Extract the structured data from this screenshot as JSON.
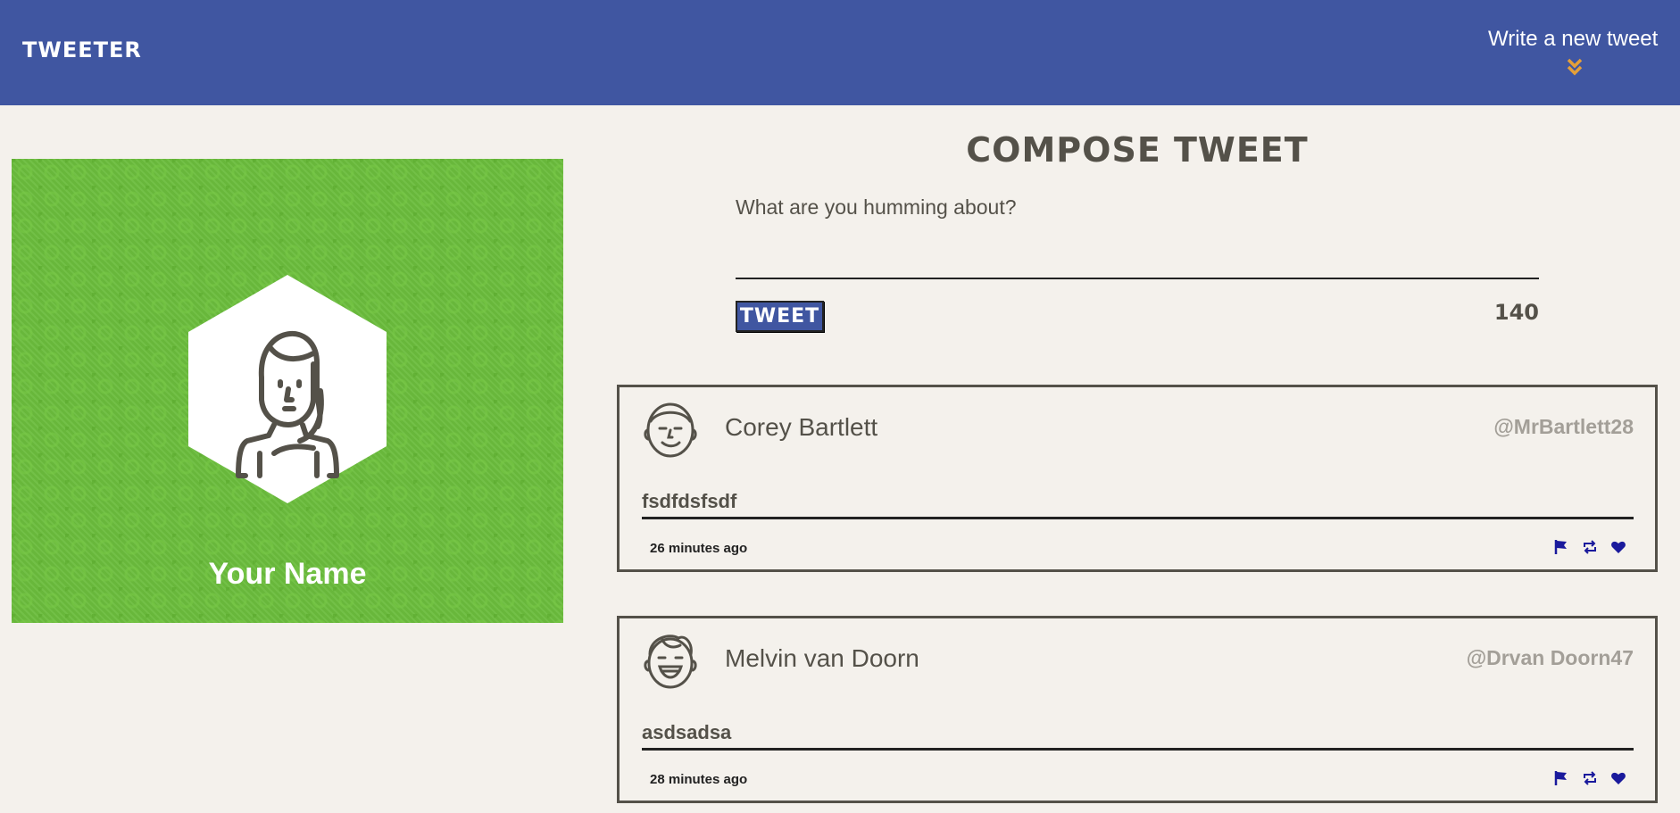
{
  "nav": {
    "brand": "TWEETER",
    "compose_toggle": "Write a new tweet",
    "compose_icon": "double-chevron-down-icon",
    "accent": "#e5a039"
  },
  "profile": {
    "name": "Your Name",
    "avatar_icon": "woman-avatar-icon"
  },
  "compose": {
    "title": "COMPOSE TWEET",
    "placeholder": "What are you humming about?",
    "value": "",
    "button": "TWEET",
    "counter": "140"
  },
  "tweets": [
    {
      "author": "Corey Bartlett",
      "handle": "@MrBartlett28",
      "text": "fsdfdsfsdf",
      "time": "26 minutes ago",
      "avatar_icon": "man-avatar-icon"
    },
    {
      "author": "Melvin van Doorn",
      "handle": "@Drvan Doorn47",
      "text": "asdsadsa",
      "time": "28 minutes ago",
      "avatar_icon": "laughing-man-avatar-icon"
    }
  ],
  "colors": {
    "nav": "#4056a1",
    "background": "#f4f1ec",
    "text": "#545149",
    "profile_bg": "#6bbd3d",
    "action_icons": "#1a1a9c"
  }
}
